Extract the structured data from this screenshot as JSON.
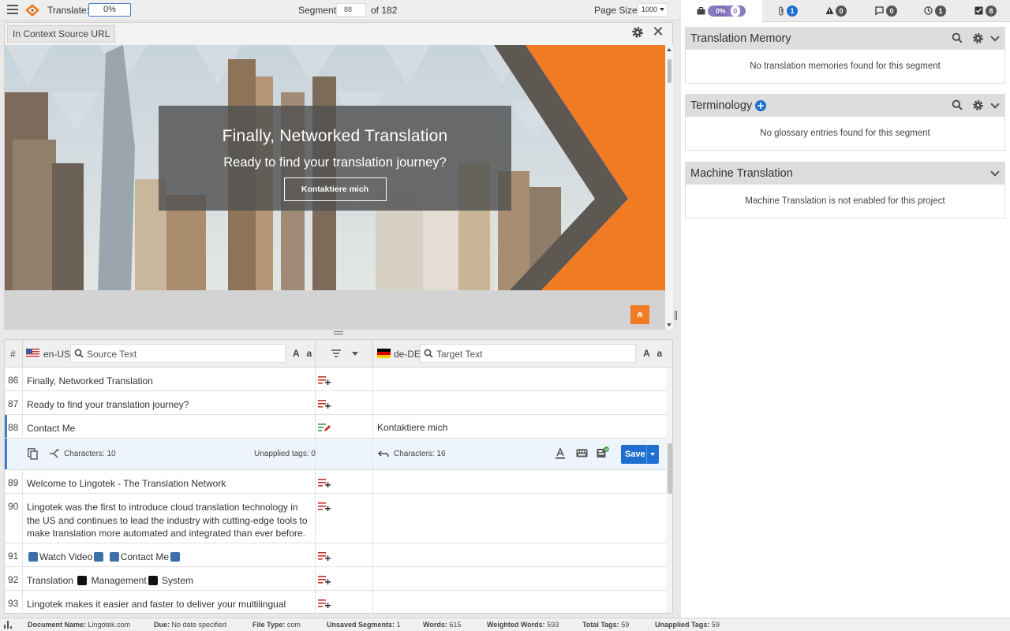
{
  "topbar": {
    "translate_label": "Translate:",
    "progress": "0%",
    "segment_label": "Segment",
    "segment_value": "88",
    "of_label": "of 182",
    "page_size_label": "Page Size:",
    "page_size_value": "1000"
  },
  "preview": {
    "url_tab": "In Context Source URL",
    "hero_title": "Finally, Networked Translation",
    "hero_subtitle": "Ready to find your translation journey?",
    "hero_button": "Kontaktiere mich",
    "accent_color": "#f07b22"
  },
  "grid": {
    "hash": "#",
    "source_lang": "en-US",
    "source_placeholder": "Source Text",
    "target_lang": "de-DE",
    "target_placeholder": "Target Text",
    "aa": "A a",
    "rows": [
      {
        "num": "86",
        "source": "Finally, Networked Translation",
        "target": ""
      },
      {
        "num": "87",
        "source": "Ready to find your translation journey?",
        "target": ""
      },
      {
        "num": "88",
        "source": "Contact Me",
        "target": "Kontaktiere mich"
      },
      {
        "num": "89",
        "source": "Welcome to Lingotek - The Translation Network",
        "target": ""
      },
      {
        "num": "90",
        "source": "Lingotek was the first to introduce cloud translation technology in the US and continues to lead the industry with cutting-edge tools to make translation more automated and integrated than ever before.",
        "target": ""
      },
      {
        "num": "91",
        "source_parts": [
          "Watch Video",
          "Contact Me"
        ],
        "target": ""
      },
      {
        "num": "92",
        "source_parts": [
          "Translation",
          "Management",
          "System"
        ],
        "target": ""
      },
      {
        "num": "93",
        "source": "Lingotek makes it easier and faster to deliver your multilingual content to",
        "target": ""
      }
    ],
    "active_ext": {
      "source_chars": "Characters: 10",
      "unapplied_tags": "Unapplied tags: 0",
      "target_chars": "Characters: 16",
      "save": "Save"
    }
  },
  "right_tabs": [
    {
      "name": "briefcase",
      "pills": [
        "0%",
        "0",
        "0"
      ]
    },
    {
      "name": "paperclip",
      "count": "1"
    },
    {
      "name": "warning",
      "count": "0"
    },
    {
      "name": "comment",
      "count": "0"
    },
    {
      "name": "clock",
      "count": "1"
    },
    {
      "name": "check",
      "count": "8"
    }
  ],
  "panels": {
    "tm_title": "Translation Memory",
    "tm_body": "No translation memories found for this segment",
    "term_title": "Terminology",
    "term_body": "No glossary entries found for this segment",
    "mt_title": "Machine Translation",
    "mt_body": "Machine Translation is not enabled for this project"
  },
  "status": {
    "doc_label": "Document Name:",
    "doc_value": "Lingotek.com",
    "due_label": "Due:",
    "due_value": "No date specified",
    "ft_label": "File Type:",
    "ft_value": "com",
    "us_label": "Unsaved Segments:",
    "us_value": "1",
    "w_label": "Words:",
    "w_value": "615",
    "ww_label": "Weighted Words:",
    "ww_value": "593",
    "tt_label": "Total Tags:",
    "tt_value": "59",
    "ut_label": "Unapplied Tags:",
    "ut_value": "59"
  }
}
